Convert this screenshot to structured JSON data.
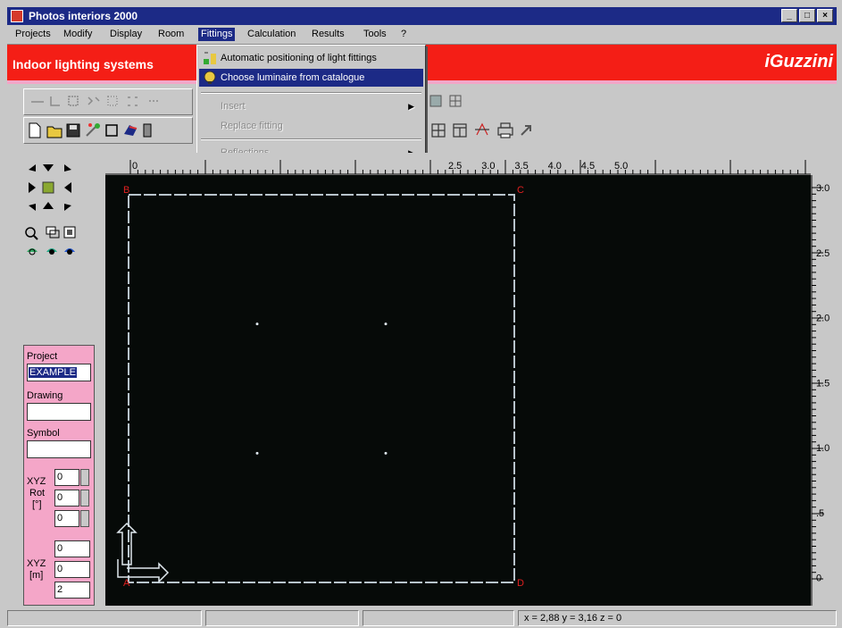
{
  "window": {
    "title": "Photos interiors 2000",
    "min": "_",
    "max": "□",
    "close": "×"
  },
  "menu": [
    "Projects",
    "Modify",
    "Display",
    "Room",
    "Fittings",
    "Calculation",
    "Results",
    "Tools",
    "?"
  ],
  "banner": {
    "left_text": "Indoor lighting systems",
    "right_text": "iGuzzini",
    "color": "#f41e16"
  },
  "fittings_menu": {
    "items": [
      {
        "label": "Automatic positioning of light fittings",
        "state": "normal"
      },
      {
        "label": "Choose luminaire from catalogue",
        "state": "selected"
      },
      {
        "label": "Insert",
        "state": "disabled",
        "submenu": true
      },
      {
        "label": "Replace fitting",
        "state": "disabled"
      },
      {
        "label": "Reflections",
        "state": "disabled",
        "submenu": true
      }
    ]
  },
  "left_panel": {
    "project_label": "Project",
    "project_value": "EXAMPLE",
    "drawing_label": "Drawing",
    "drawing_value": "",
    "symbol_label": "Symbol",
    "symbol_value": "",
    "rot_label_1": "XYZ",
    "rot_label_2": "Rot",
    "rot_label_3": "[°]",
    "rot_values": [
      "0",
      "0",
      "0"
    ],
    "pos_label_1": "XYZ",
    "pos_label_2": "[m]",
    "pos_values": [
      "0",
      "0",
      "2"
    ]
  },
  "ruler_top": {
    "labels": [
      {
        "text": "0",
        "pos": 0
      },
      {
        "text": "2.5",
        "pos": 2.5
      },
      {
        "text": "3.0",
        "pos": 3.0
      },
      {
        "text": "3.5",
        "pos": 3.5
      },
      {
        "text": "4.0",
        "pos": 4.0
      },
      {
        "text": "4.5",
        "pos": 4.5
      },
      {
        "text": "5.0",
        "pos": 5.0
      }
    ]
  },
  "ruler_right": {
    "labels": [
      {
        "text": "3.0",
        "pos": 3.0
      },
      {
        "text": "2.5",
        "pos": 2.5
      },
      {
        "text": "2.0",
        "pos": 2.0
      },
      {
        "text": "1.5",
        "pos": 1.5
      },
      {
        "text": "1.0",
        "pos": 1.0
      },
      {
        "text": ".5",
        "pos": 0.5
      },
      {
        "text": "0",
        "pos": 0
      }
    ]
  },
  "room": {
    "corners": {
      "A": "A",
      "B": "B",
      "C": "C",
      "D": "D"
    },
    "width_m": 3.0,
    "depth_m": 3.0,
    "fittings": [
      {
        "x": 1.0,
        "y": 2.0
      },
      {
        "x": 2.0,
        "y": 2.0
      },
      {
        "x": 1.0,
        "y": 1.0
      },
      {
        "x": 2.0,
        "y": 1.0
      }
    ]
  },
  "status": {
    "coords": "x = 2,88  y = 3,16  z = 0"
  },
  "colors": {
    "title_bar": "#1c2a86",
    "banner": "#f41e16",
    "canvas": "#060a08",
    "panel_pink": "#f4a6c8",
    "corner_labels": "#e02020"
  }
}
